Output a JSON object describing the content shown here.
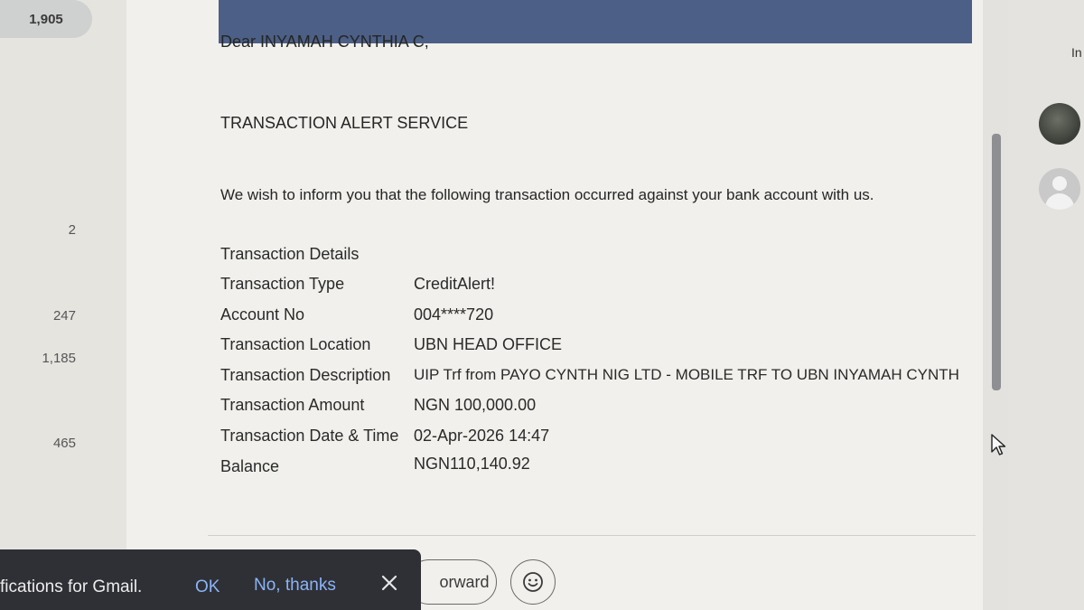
{
  "nav_counts": {
    "badge": "1,905",
    "items": [
      "2",
      "247",
      "1,185",
      "465"
    ]
  },
  "email": {
    "greeting": "Dear INYAMAH CYNTHIA C,",
    "heading": "TRANSACTION ALERT SERVICE",
    "intro": "We wish to inform you that the following transaction occurred against your bank account with us.",
    "details_title": "Transaction Details",
    "rows": [
      {
        "label": "Transaction Type",
        "value": "CreditAlert!"
      },
      {
        "label": "Account No",
        "value": "004****720"
      },
      {
        "label": "Transaction Location",
        "value": "UBN HEAD OFFICE"
      },
      {
        "label": "Transaction Description",
        "value": "UIP Trf from PAYO CYNTH NIG LTD - MOBILE TRF TO UBN INYAMAH CYNTH"
      },
      {
        "label": "Transaction Amount",
        "value": "NGN 100,000.00"
      },
      {
        "label": "Transaction Date & Time",
        "value": "02-Apr-2026 14:47"
      },
      {
        "label": "Balance",
        "value": "NGN110,140.92"
      }
    ]
  },
  "actions": {
    "forward_label": "orward"
  },
  "snackbar": {
    "message": "fications for Gmail.",
    "ok_label": "OK",
    "no_label": "No, thanks"
  },
  "right_panel": {
    "top_label": "In"
  },
  "icons": {
    "close": "close-icon",
    "emoji": "emoji-icon",
    "cursor": "mouse-cursor-icon",
    "avatar": "avatar-icon"
  },
  "colors": {
    "header_bar": "#4c5f86",
    "snackbar_bg": "#2f3035",
    "snackbar_link": "#8ab4f8"
  }
}
